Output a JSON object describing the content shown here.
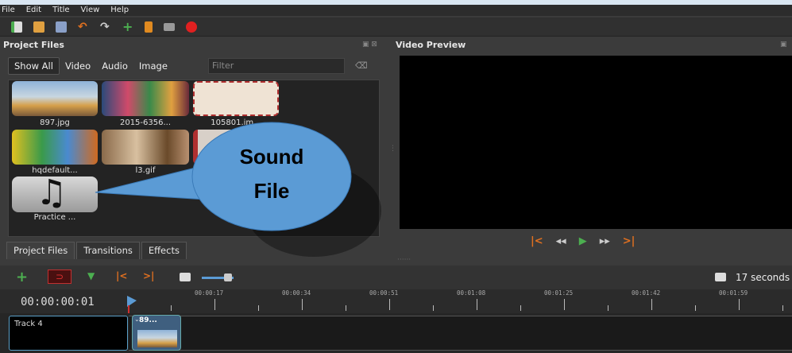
{
  "menu": [
    "File",
    "Edit",
    "Title",
    "View",
    "Help"
  ],
  "toolbar_icons": [
    "new-project-icon",
    "open-project-icon",
    "save-project-icon",
    "undo-icon",
    "redo-icon",
    "import-files-icon",
    "choose-profile-icon",
    "fullscreen-icon",
    "export-video-icon"
  ],
  "project_files": {
    "title": "Project Files",
    "filters": [
      "Show All",
      "Video",
      "Audio",
      "Image"
    ],
    "filter_placeholder": "Filter",
    "items": [
      {
        "label": "897.jpg",
        "kind": "image"
      },
      {
        "label": "2015-6356...",
        "kind": "image"
      },
      {
        "label": "105801.im...",
        "kind": "image"
      },
      {
        "label": "hqdefault...",
        "kind": "image"
      },
      {
        "label": "l3.gif",
        "kind": "image"
      },
      {
        "label": "",
        "kind": "image"
      },
      {
        "label": "Practice ...",
        "kind": "audio"
      }
    ]
  },
  "video_preview": {
    "title": "Video Preview"
  },
  "tabs": [
    "Project Files",
    "Transitions",
    "Effects"
  ],
  "callout": {
    "line1": "Sound",
    "line2": "File"
  },
  "timeline": {
    "timecode": "00:00:00:01",
    "zoom_label": "17 seconds",
    "ruler": [
      "00:00:17",
      "00:00:34",
      "00:00:51",
      "00:01:08",
      "00:01:25",
      "00:01:42",
      "00:01:59"
    ],
    "track_name": "Track 4",
    "clip_label": "89..."
  },
  "colors": {
    "accent": "#5b9bd5",
    "track_border": "#5aa0c8"
  }
}
